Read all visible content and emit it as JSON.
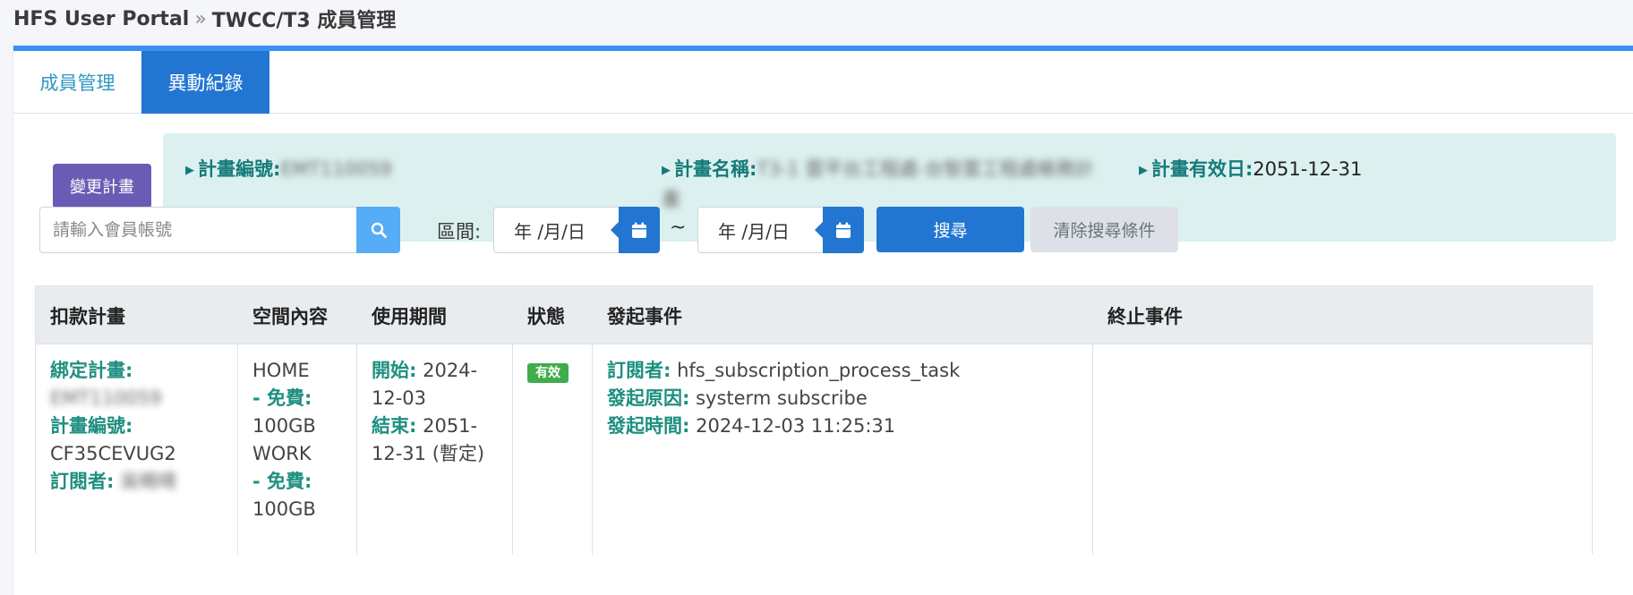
{
  "breadcrumb": {
    "root": "HFS User Portal",
    "separator": "»",
    "current": "TWCC/T3 成員管理"
  },
  "tabs": [
    {
      "label": "成員管理",
      "active": false
    },
    {
      "label": "異動紀錄",
      "active": true
    }
  ],
  "change_plan_button": "變更計畫",
  "plan_info": {
    "plan_id_label": "計畫編號:",
    "plan_id_value": "EMT110059",
    "plan_name_label": "計畫名稱:",
    "plan_name_value": "T3-1 雲平台工程處-台智雲工程處帳務計畫",
    "plan_valid_label": "計畫有效日:",
    "plan_valid_value": "2051-12-31"
  },
  "search": {
    "placeholder": "請輸入會員帳號",
    "range_label": "區間:",
    "date_start": "年 /月/日",
    "date_end": "年 /月/日",
    "range_separator": "~",
    "search_button": "搜尋",
    "clear_button": "清除搜尋條件"
  },
  "colors": {
    "accent": "#2276d2",
    "top_border": "#3b8ff0",
    "change_button": "#6b5bb4",
    "info_bg": "#dcf1ef",
    "label_teal": "#1d8f80",
    "status_green": "#3fad4c"
  },
  "icons": {
    "search": "search-icon",
    "calendar": "calendar-icon",
    "info_marker": "triangle-right-icon"
  },
  "table": {
    "headers": [
      "扣款計畫",
      "空間內容",
      "使用期間",
      "狀態",
      "發起事件",
      "終止事件"
    ],
    "rows": [
      {
        "bound_plan_label": "綁定計畫:",
        "bound_plan_value": "EMT110059",
        "plan_no_label": "計畫編號:",
        "plan_no_value": "CF35CEVUG2",
        "subscriber_label": "訂閱者:",
        "subscriber_value": "吳曉晴",
        "space_1_name": "HOME",
        "space_1_label": "- 免費:",
        "space_1_size": "100GB",
        "space_2_name": "WORK",
        "space_2_label": "- 免費:",
        "space_2_size": "100GB",
        "start_label": "開始:",
        "start_value": "2024-12-03",
        "end_label": "結束:",
        "end_value": "2051-12-31 (暫定)",
        "status": "有效",
        "initiator_label": "訂閱者:",
        "initiator_value": "hfs_subscription_process_task",
        "reason_label": "發起原因:",
        "reason_value": "systerm subscribe",
        "time_label": "發起時間:",
        "time_value": "2024-12-03 11:25:31",
        "terminate": ""
      }
    ]
  }
}
